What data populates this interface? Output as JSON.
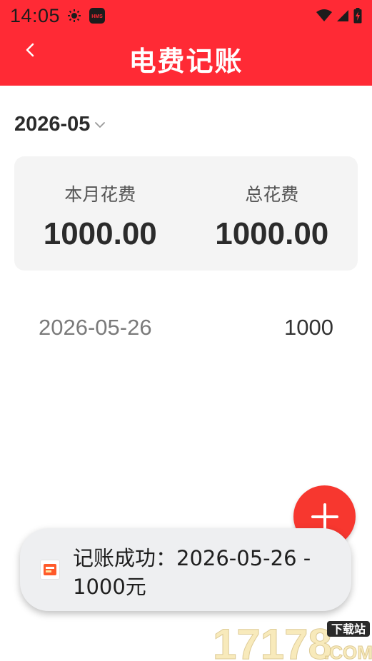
{
  "status_bar": {
    "time": "14:05",
    "notif_icon_label": "HMS"
  },
  "nav": {
    "title": "电费记账",
    "back_icon": "chevron-left-icon"
  },
  "month_picker": {
    "value": "2026-05",
    "icon": "chevron-down-icon"
  },
  "summary": {
    "monthly_label": "本月花费",
    "monthly_value": "1000.00",
    "total_label": "总花费",
    "total_value": "1000.00"
  },
  "records": [
    {
      "date": "2026-05-26",
      "amount": "1000"
    }
  ],
  "fab": {
    "icon": "plus-icon"
  },
  "toast": {
    "message": "记账成功：2026-05-26 - 1000元"
  },
  "watermark": {
    "brand": "17178",
    "tag": "下载站",
    "suffix": ".COM"
  },
  "colors": {
    "header_red": "#ff2a35",
    "fab_red": "#f7372f",
    "card_bg": "#f4f4f4",
    "toast_bg": "#eeeff1"
  }
}
